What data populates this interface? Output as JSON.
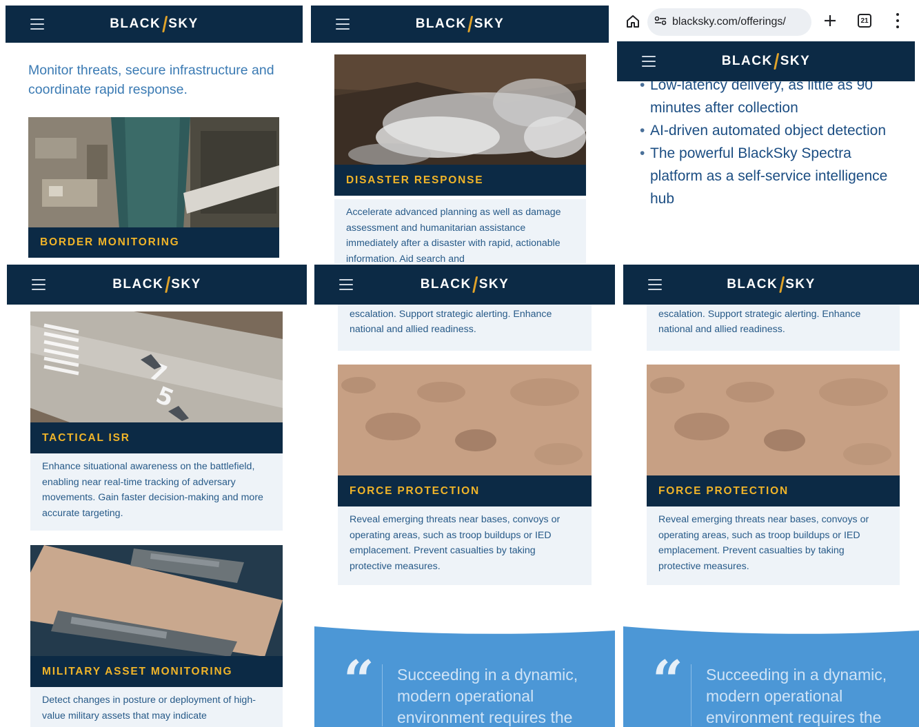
{
  "brand": {
    "left": "BLACK",
    "right": "SKY"
  },
  "colors": {
    "navy": "#0c2a45",
    "gold": "#f0b429",
    "light_bg": "#eef3f8",
    "text_blue": "#275a88",
    "quote_blue": "#4c97d6"
  },
  "panel1": {
    "lead": "Monitor threats, secure infrastructure and coordinate rapid response.",
    "card_label": "BORDER MONITORING"
  },
  "panel2": {
    "card_label": "DISASTER RESPONSE",
    "card_desc": "Accelerate advanced planning as well as damage assessment and humanitarian assistance immediately after a disaster with rapid, actionable information. Aid search and"
  },
  "panel3": {
    "url": "blacksky.com/offerings/",
    "tab_count": "21",
    "bullets": [
      "Low-latency delivery, as little as 90 minutes after collection",
      "AI-driven automated object detection",
      "The powerful BlackSky Spectra platform as a self-service intelligence hub"
    ]
  },
  "panel4": {
    "card1_label": "TACTICAL ISR",
    "card1_desc": "Enhance situational awareness on the battlefield, enabling near real-time tracking of adversary movements. Gain faster decision-making and more accurate targeting.",
    "card2_label": "MILITARY ASSET MONITORING",
    "card2_desc": "Detect changes in posture or deployment of high-value military assets that may indicate"
  },
  "panel5": {
    "prev_desc": "value military assets that may indicate aggression or escalation. Support strategic alerting. Enhance national and allied readiness.",
    "card_label": "FORCE PROTECTION",
    "card_desc": "Reveal emerging threats near bases, convoys or operating areas, such as troop buildups or IED emplacement. Prevent casualties by taking protective measures.",
    "quote": "Succeeding in a dynamic, modern operational environment requires the"
  },
  "panel6": {
    "prev_desc": "value military assets that may indicate aggression or escalation. Support strategic alerting. Enhance national and allied readiness.",
    "card_label": "FORCE PROTECTION",
    "card_desc": "Reveal emerging threats near bases, convoys or operating areas, such as troop buildups or IED emplacement. Prevent casualties by taking protective measures.",
    "quote": "Succeeding in a dynamic, modern operational environment requires the"
  }
}
